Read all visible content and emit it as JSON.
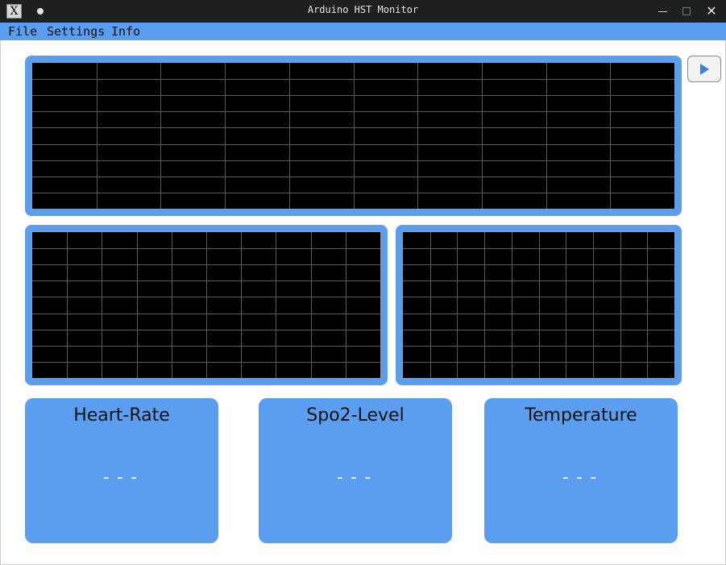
{
  "window": {
    "title": "Arduino HST Monitor",
    "app_icon": "x-window-icon",
    "buttons": [
      "minimize-icon",
      "maximize-icon",
      "close-icon"
    ],
    "close_glyph": "✕"
  },
  "menu": {
    "items": [
      {
        "label": "File"
      },
      {
        "label": "Settings"
      },
      {
        "label": "Info"
      }
    ]
  },
  "toolbar": {
    "play_icon": "play-icon"
  },
  "cards": [
    {
      "title": "Heart-Rate",
      "value": "---"
    },
    {
      "title": "Spo2-Level",
      "value": "---"
    },
    {
      "title": "Temperature",
      "value": "---"
    }
  ],
  "colors": {
    "accent": "#5b9ef0",
    "plot_background": "#000000",
    "grid": "#5a5a5a",
    "titlebar": "#1f1f1f"
  }
}
